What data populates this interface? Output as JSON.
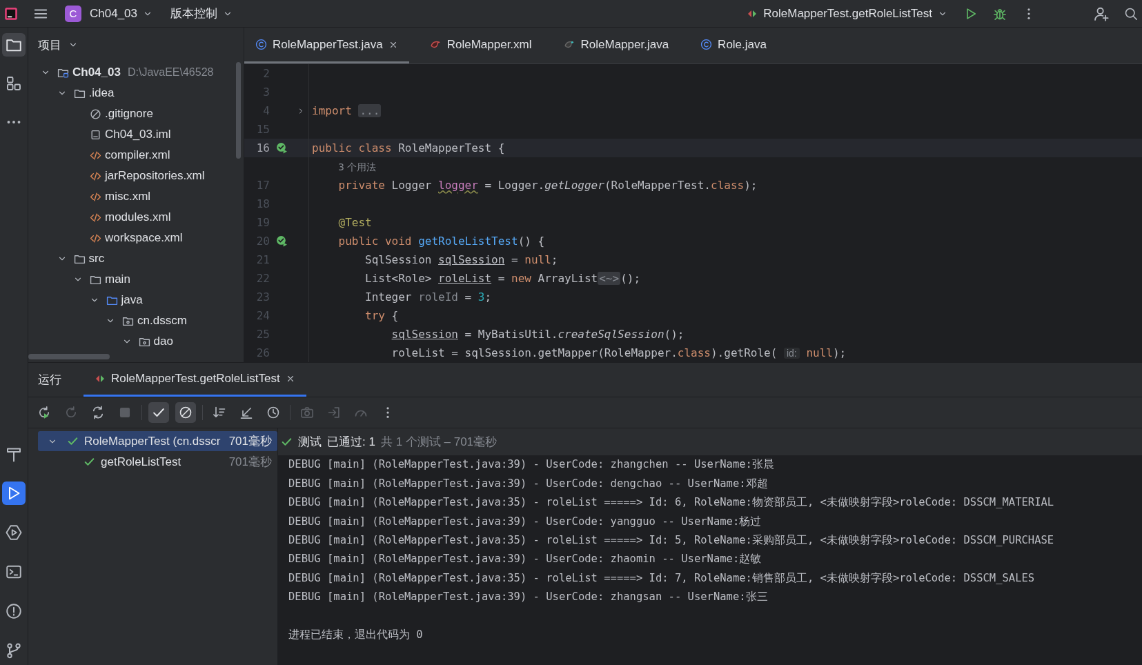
{
  "top_bar": {
    "project": {
      "badge": "C",
      "name": "Ch04_03"
    },
    "vcs": "版本控制",
    "run_config": "RoleMapperTest.getRoleListTest"
  },
  "tool_strip": {
    "top": [
      {
        "kind": "folder",
        "selected": true
      },
      {
        "kind": "structure",
        "selected": false
      },
      {
        "kind": "more",
        "selected": false
      }
    ],
    "bottom": [
      {
        "kind": "build",
        "selected": false
      },
      {
        "kind": "run",
        "selected": true
      },
      {
        "kind": "services",
        "selected": false
      },
      {
        "kind": "terminal",
        "selected": false
      },
      {
        "kind": "problems",
        "selected": false
      },
      {
        "kind": "git",
        "selected": false
      }
    ]
  },
  "project_panel": {
    "title": "项目",
    "tree": [
      {
        "label": "Ch04_03",
        "path": "D:\\JavaEE\\46528",
        "kind": "module",
        "expanded": true,
        "children": [
          {
            "label": ".idea",
            "kind": "folder",
            "expanded": true,
            "children": [
              {
                "label": ".gitignore",
                "kind": "ignore"
              },
              {
                "label": "Ch04_03.iml",
                "kind": "iml"
              },
              {
                "label": "compiler.xml",
                "kind": "xml"
              },
              {
                "label": "jarRepositories.xml",
                "kind": "xml"
              },
              {
                "label": "misc.xml",
                "kind": "xml"
              },
              {
                "label": "modules.xml",
                "kind": "xml"
              },
              {
                "label": "workspace.xml",
                "kind": "xml"
              }
            ]
          },
          {
            "label": "src",
            "kind": "folder",
            "expanded": true,
            "children": [
              {
                "label": "main",
                "kind": "folder",
                "expanded": true,
                "children": [
                  {
                    "label": "java",
                    "kind": "source",
                    "expanded": true,
                    "children": [
                      {
                        "label": "cn.dsscm",
                        "kind": "package",
                        "expanded": true,
                        "children": [
                          {
                            "label": "dao",
                            "kind": "package",
                            "expanded": true
                          }
                        ]
                      }
                    ]
                  }
                ]
              }
            ]
          }
        ]
      }
    ]
  },
  "editor": {
    "tabs": [
      {
        "label": "RoleMapperTest.java",
        "kind": "class",
        "selected": true
      },
      {
        "label": "RoleMapper.xml",
        "kind": "mybatis",
        "selected": false
      },
      {
        "label": "RoleMapper.java",
        "kind": "mapper",
        "selected": false
      },
      {
        "label": "Role.java",
        "kind": "class",
        "selected": false
      }
    ],
    "lines": [
      {
        "number": "2",
        "current": false
      },
      {
        "number": "3",
        "current": false
      },
      {
        "number": "4",
        "current": false,
        "folded": true,
        "tokens": [
          {
            "kind": "kw",
            "text": "import "
          },
          {
            "kind": "fold",
            "text": "..."
          }
        ]
      },
      {
        "number": "15",
        "current": false
      },
      {
        "number": "16",
        "current": true,
        "run_marker": true,
        "tokens": [
          {
            "kind": "kw",
            "text": "public class "
          },
          {
            "kind": "plain",
            "text": "RoleMapperTest {"
          }
        ]
      },
      {
        "current": false,
        "tokens": [
          {
            "kind": "usage",
            "text": "3 个用法"
          }
        ]
      },
      {
        "number": "17",
        "current": false,
        "tokens": [
          {
            "kind": "kw",
            "text": "    private "
          },
          {
            "kind": "plain",
            "text": "Logger "
          },
          {
            "kind": "field",
            "text": "logger"
          },
          {
            "kind": "plain",
            "text": " = Logger."
          },
          {
            "kind": "static",
            "text": "getLogger"
          },
          {
            "kind": "plain",
            "text": "(RoleMapperTest."
          },
          {
            "kind": "kw",
            "text": "class"
          },
          {
            "kind": "plain",
            "text": ");"
          }
        ]
      },
      {
        "number": "18",
        "current": false
      },
      {
        "number": "19",
        "current": false,
        "tokens": [
          {
            "kind": "annotation",
            "text": "    @Test"
          }
        ]
      },
      {
        "number": "20",
        "current": false,
        "run_marker": true,
        "tokens": [
          {
            "kind": "kw",
            "text": "    public void "
          },
          {
            "kind": "fn",
            "text": "getRoleListTest"
          },
          {
            "kind": "plain",
            "text": "() {"
          }
        ]
      },
      {
        "number": "21",
        "current": false,
        "tokens": [
          {
            "kind": "plain",
            "text": "        SqlSession "
          },
          {
            "kind": "var",
            "text": "sqlSession"
          },
          {
            "kind": "plain",
            "text": " = "
          },
          {
            "kind": "kw",
            "text": "null"
          },
          {
            "kind": "plain",
            "text": ";"
          }
        ]
      },
      {
        "number": "22",
        "current": false,
        "tokens": [
          {
            "kind": "plain",
            "text": "        List<Role> "
          },
          {
            "kind": "var",
            "text": "roleList"
          },
          {
            "kind": "plain",
            "text": " = "
          },
          {
            "kind": "kw",
            "text": "new "
          },
          {
            "kind": "plain",
            "text": "ArrayList"
          },
          {
            "kind": "fold",
            "text": "<~>"
          },
          {
            "kind": "plain",
            "text": "();"
          }
        ]
      },
      {
        "number": "23",
        "current": false,
        "tokens": [
          {
            "kind": "plain",
            "text": "        Integer "
          },
          {
            "kind": "unused",
            "text": "roleId"
          },
          {
            "kind": "plain",
            "text": " = "
          },
          {
            "kind": "num",
            "text": "3"
          },
          {
            "kind": "plain",
            "text": ";"
          }
        ]
      },
      {
        "number": "24",
        "current": false,
        "tokens": [
          {
            "kind": "kw",
            "text": "        try "
          },
          {
            "kind": "plain",
            "text": "{"
          }
        ]
      },
      {
        "number": "25",
        "current": false,
        "tokens": [
          {
            "kind": "var",
            "text": "            sqlSession"
          },
          {
            "kind": "plain",
            "text": " = MyBatisUtil."
          },
          {
            "kind": "static",
            "text": "createSqlSession"
          },
          {
            "kind": "plain",
            "text": "();"
          }
        ]
      },
      {
        "number": "26",
        "current": false,
        "tokens": [
          {
            "kind": "plain",
            "text": "            roleList = sqlSession.getMapper(RoleMapper."
          },
          {
            "kind": "kw",
            "text": "class"
          },
          {
            "kind": "plain",
            "text": ").getRole( "
          },
          {
            "kind": "hint",
            "text": "id:"
          },
          {
            "kind": "kw",
            "text": " null"
          },
          {
            "kind": "plain",
            "text": ");"
          }
        ]
      }
    ]
  },
  "run_panel": {
    "title": "运行",
    "tabs": [
      {
        "label": "RoleMapperTest.getRoleListTest",
        "selected": true
      }
    ],
    "toolbar": [
      {
        "kind": "rerun",
        "disabled": false,
        "on": false
      },
      {
        "kind": "rerun-failed",
        "disabled": true,
        "on": false
      },
      {
        "kind": "auto-test",
        "disabled": false,
        "on": false
      },
      {
        "kind": "stop",
        "disabled": true,
        "on": false
      },
      {
        "kind": "show-passed",
        "disabled": false,
        "on": true
      },
      {
        "kind": "show-ignored",
        "disabled": false,
        "on": true
      },
      {
        "kind": "sort",
        "disabled": false,
        "on": false
      },
      {
        "kind": "import",
        "disabled": false,
        "on": false
      },
      {
        "kind": "history",
        "disabled": false,
        "on": false
      },
      {
        "kind": "camera",
        "disabled": true,
        "on": false
      },
      {
        "kind": "export",
        "disabled": true,
        "on": false
      },
      {
        "kind": "gauge",
        "disabled": true,
        "on": false
      },
      {
        "kind": "more",
        "disabled": false,
        "on": false
      }
    ],
    "tests": [
      {
        "label": "RoleMapperTest (cn.dsscr",
        "time": "701毫秒",
        "passed": true,
        "selected": true,
        "expanded": true,
        "children": [
          {
            "label": "getRoleListTest",
            "time": "701毫秒",
            "passed": true,
            "selected": false
          }
        ]
      }
    ],
    "status": {
      "label": "测试",
      "result": "已通过: 1",
      "summary": "共 1 个测试 – 701毫秒"
    },
    "console": [
      "DEBUG [main] (RoleMapperTest.java:39) - UserCode: zhangchen -- UserName:张晨",
      "DEBUG [main] (RoleMapperTest.java:39) - UserCode: dengchao -- UserName:邓超",
      "DEBUG [main] (RoleMapperTest.java:35) - roleList =====> Id: 6, RoleName:物资部员工, <未做映射字段>roleCode: DSSCM_MATERIAL",
      "DEBUG [main] (RoleMapperTest.java:39) - UserCode: yangguo -- UserName:杨过",
      "DEBUG [main] (RoleMapperTest.java:35) - roleList =====> Id: 5, RoleName:采购部员工, <未做映射字段>roleCode: DSSCM_PURCHASE",
      "DEBUG [main] (RoleMapperTest.java:39) - UserCode: zhaomin -- UserName:赵敏",
      "DEBUG [main] (RoleMapperTest.java:35) - roleList =====> Id: 7, RoleName:销售部员工, <未做映射字段>roleCode: DSSCM_SALES",
      "DEBUG [main] (RoleMapperTest.java:39) - UserCode: zhangsan -- UserName:张三"
    ],
    "exit_message": "进程已结束，退出代码为 0"
  }
}
